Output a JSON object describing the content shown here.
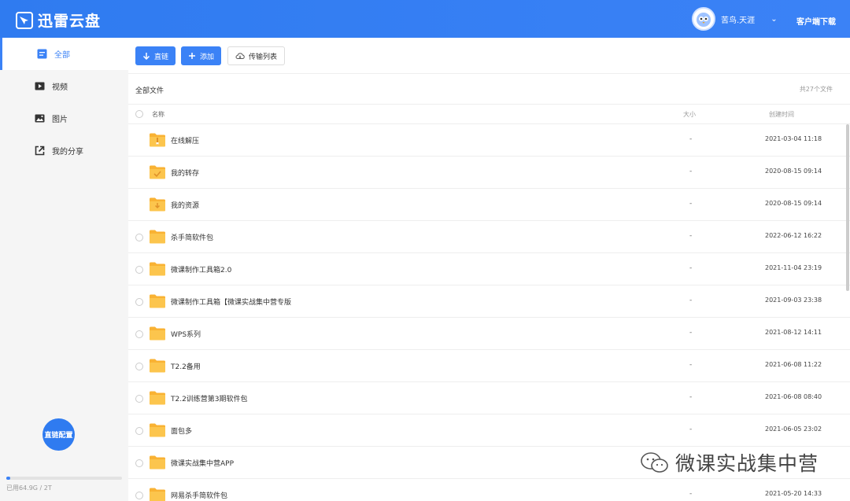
{
  "app": {
    "title": "迅雷云盘"
  },
  "user": {
    "name": "苦鸟.天涯",
    "client_download": "客户端下载"
  },
  "sidebar": {
    "items": [
      {
        "label": "全部",
        "icon": "file-list-icon",
        "active": true
      },
      {
        "label": "视频",
        "icon": "video-icon",
        "active": false
      },
      {
        "label": "图片",
        "icon": "image-icon",
        "active": false
      },
      {
        "label": "我的分享",
        "icon": "share-icon",
        "active": false
      }
    ],
    "config_button": "直链配置",
    "usage": {
      "text": "已用64.9G / 2T",
      "fraction": 0.032
    }
  },
  "toolbar": {
    "direct_link": "直链",
    "add": "添加",
    "transfer_list": "传输列表"
  },
  "crumb": {
    "title": "全部文件",
    "total": "共27个文件"
  },
  "table": {
    "headers": {
      "name": "名称",
      "size": "大小",
      "created": "创建时间"
    },
    "rows": [
      {
        "name": "在线解压",
        "size": "-",
        "date": "2021-03-04 11:18",
        "system": true,
        "badge": "zip"
      },
      {
        "name": "我的转存",
        "size": "-",
        "date": "2020-08-15 09:14",
        "system": true,
        "badge": "save"
      },
      {
        "name": "我的资源",
        "size": "-",
        "date": "2020-08-15 09:14",
        "system": true,
        "badge": "down"
      },
      {
        "name": "杀手简软件包",
        "size": "-",
        "date": "2022-06-12 16:22",
        "system": false
      },
      {
        "name": "微课制作工具箱2.0",
        "size": "-",
        "date": "2021-11-04 23:19",
        "system": false
      },
      {
        "name": "微课制作工具箱【微课实战集中营专版",
        "size": "-",
        "date": "2021-09-03 23:38",
        "system": false
      },
      {
        "name": "WPS系列",
        "size": "-",
        "date": "2021-08-12 14:11",
        "system": false
      },
      {
        "name": "T2.2备用",
        "size": "-",
        "date": "2021-06-08 11:22",
        "system": false
      },
      {
        "name": "T2.2训练营第3期软件包",
        "size": "-",
        "date": "2021-06-08 08:40",
        "system": false
      },
      {
        "name": "面包多",
        "size": "-",
        "date": "2021-06-05 23:02",
        "system": false
      },
      {
        "name": "微课实战集中营APP",
        "size": "-",
        "date": "",
        "system": false
      },
      {
        "name": "网易杀手简软件包",
        "size": "-",
        "date": "2021-05-20 14:33",
        "system": false
      }
    ]
  },
  "watermark": {
    "text": "微课实战集中营"
  },
  "colors": {
    "brand": "#3b82f6",
    "folder": "#f9b233"
  }
}
